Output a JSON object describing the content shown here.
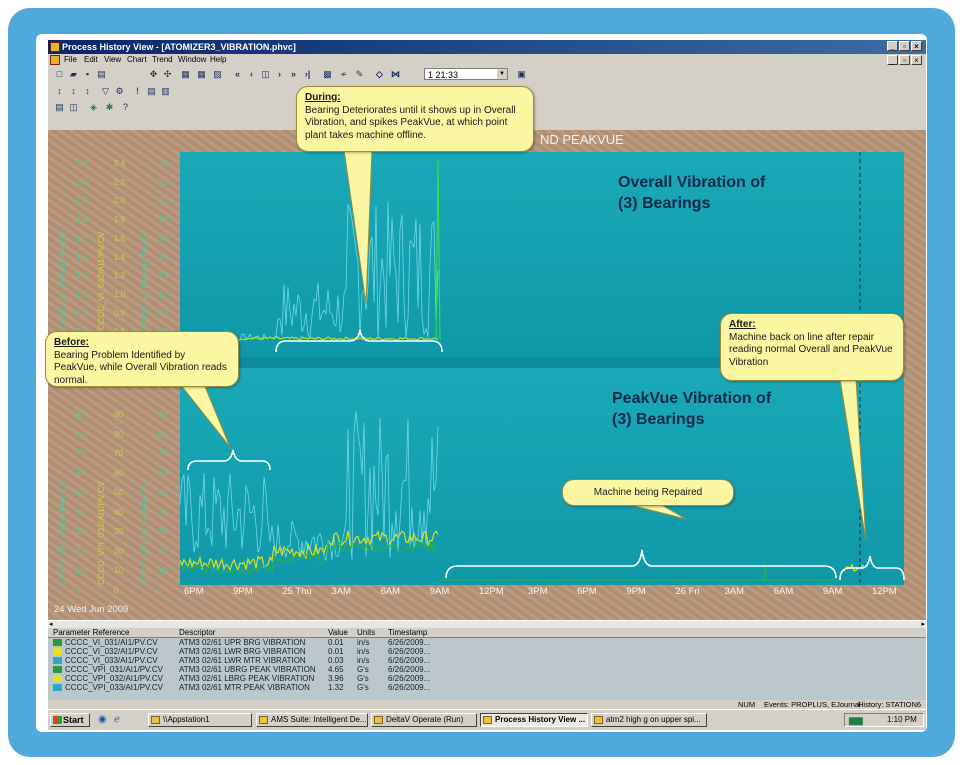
{
  "window": {
    "title": "Process History View - [ATOMIZER3_VIBRATION.phvc]",
    "menu": [
      "File",
      "Edit",
      "View",
      "Chart",
      "Trend",
      "Window",
      "Help"
    ],
    "time_field": "1  21:33"
  },
  "chart": {
    "title_fragment": "ND PEAKVUE",
    "start_date": "24 Wed Jun 2009",
    "x_ticks": [
      "6PM",
      "9PM",
      "25 Thu",
      "3AM",
      "6AM",
      "9AM",
      "12PM",
      "3PM",
      "6PM",
      "9PM",
      "26 Fri",
      "3AM",
      "6AM",
      "9AM",
      "12PM"
    ],
    "top_axis_ticks": [
      "2.4",
      "2.2",
      "2.0",
      "1.8",
      "1.6",
      "1.4",
      "1.2",
      "1.0",
      "0.8",
      "0.6"
    ],
    "bottom_axis_ticks": [
      "90",
      "80",
      "70",
      "60",
      "50",
      "40",
      "30",
      "20",
      "10",
      "0"
    ],
    "top_axis_labels": [
      "CCCC_VI_033/AI1/PV.CV",
      "CCCC_VI_032/AI1/PV.CV",
      "CCCC_VI_031/AI1/PV.CV"
    ],
    "bottom_axis_labels": [
      "CCCC_VPI_033/AI1/PV.CV",
      "CCCC_VPI_032/AI1/PV.CV",
      "CCCC_VPI_031/AI1/PV.CV"
    ]
  },
  "annotations": {
    "overall_title": [
      "Overall Vibration of",
      "(3)  Bearings"
    ],
    "peakvue_title": [
      "PeakVue Vibration of",
      "(3) Bearings"
    ],
    "during_heading": "During:",
    "during_text": "Bearing Deteriorates until it shows up in Overall Vibration, and spikes PeakVue, at which point plant takes machine offline.",
    "before_heading": "Before:",
    "before_text": "Bearing Problem Identified by PeakVue, while Overall Vibration reads normal.",
    "after_heading": "After:",
    "after_text": "Machine back on line after repair reading normal Overall and PeakVue Vibration",
    "repaired_text": "Machine being Repaired"
  },
  "table": {
    "headers": [
      "Parameter Reference",
      "Descriptor",
      "Value",
      "Units",
      "Timestamp"
    ],
    "rows": [
      {
        "ref": "CCCC_VI_031/AI1/PV.CV",
        "desc": "ATM3 02/61 UPR BRG VIBRATION",
        "value": "0.01",
        "units": "in/s",
        "ts": "6/26/2009...",
        "color": "#2a9a3a"
      },
      {
        "ref": "CCCC_VI_032/AI1/PV.CV",
        "desc": "ATM3 02/61 LWR BRG VIBRATION",
        "value": "0.01",
        "units": "in/s",
        "ts": "6/26/2009...",
        "color": "#e8e020"
      },
      {
        "ref": "CCCC_VI_033/AI1/PV.CV",
        "desc": "ATM3 02/61 LWR MTR VIBRATION",
        "value": "0.03",
        "units": "in/s",
        "ts": "6/26/2009...",
        "color": "#2aa8c8"
      },
      {
        "ref": "CCCC_VPI_031/AI1/PV.CV",
        "desc": "ATM3 02/61 UBRG PEAK VIBRATION",
        "value": "4.65",
        "units": "G's",
        "ts": "6/26/2009...",
        "color": "#2a9a3a"
      },
      {
        "ref": "CCCC_VPI_032/AI1/PV.CV",
        "desc": "ATM3 02/61 LBRG PEAK VIBRATION",
        "value": "3.96",
        "units": "G's",
        "ts": "6/26/2009...",
        "color": "#e8e020"
      },
      {
        "ref": "CCCC_VPI_033/AI1/PV.CV",
        "desc": "ATM3 02/61 MTR PEAK VIBRATION",
        "value": "1.32",
        "units": "G's",
        "ts": "6/26/2009...",
        "color": "#2aa8c8"
      }
    ]
  },
  "status": {
    "num": "NUM",
    "events": "Events: PROPLUS, EJournal",
    "history": "History: STATION6"
  },
  "taskbar": {
    "start": "Start",
    "tasks": [
      "\\\\Appstation1",
      "AMS Suite: Intelligent De...",
      "DeltaV Operate (Run)",
      "Process History View ...",
      "atm2 high g on upper spi..."
    ],
    "clock": "1:10 PM"
  }
}
